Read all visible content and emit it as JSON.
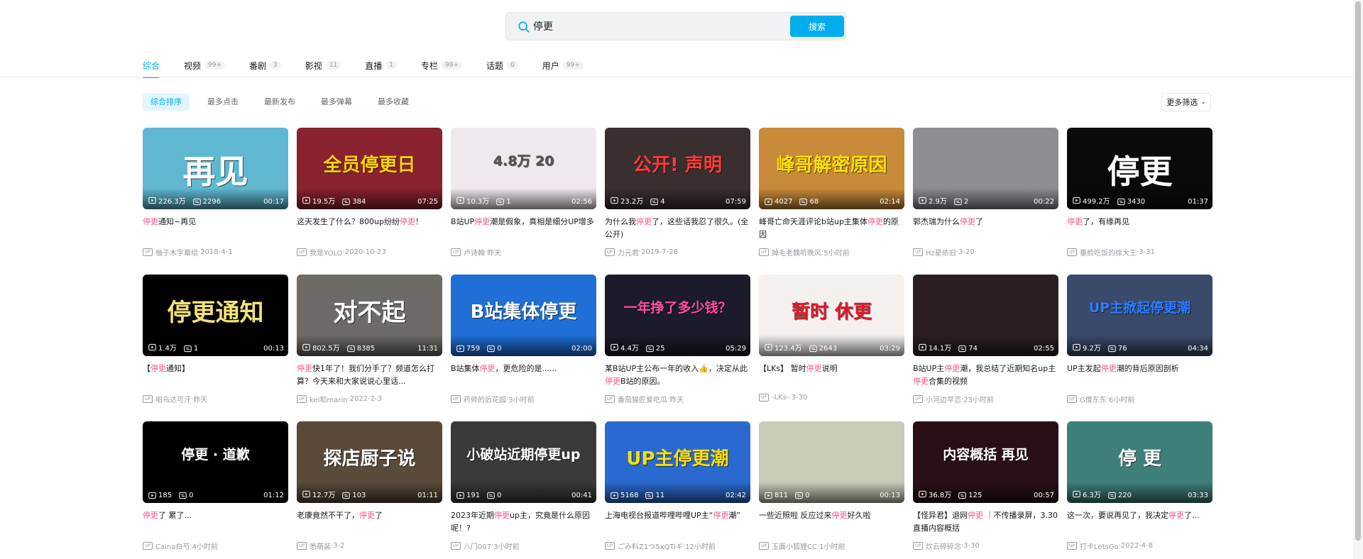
{
  "search": {
    "value": "停更",
    "button_label": "搜索"
  },
  "tabs": [
    {
      "label": "综合",
      "count": "",
      "active": true
    },
    {
      "label": "视频",
      "count": "99+"
    },
    {
      "label": "番剧",
      "count": "3"
    },
    {
      "label": "影视",
      "count": "11"
    },
    {
      "label": "直播",
      "count": "1"
    },
    {
      "label": "专栏",
      "count": "99+"
    },
    {
      "label": "话题",
      "count": "0"
    },
    {
      "label": "用户",
      "count": "99+"
    }
  ],
  "sort": [
    {
      "label": "综合排序",
      "active": true
    },
    {
      "label": "最多点击"
    },
    {
      "label": "最新发布"
    },
    {
      "label": "最多弹幕"
    },
    {
      "label": "最多收藏"
    }
  ],
  "filter_label": "更多筛选",
  "videos": [
    {
      "thumb_text": "再见",
      "thumb_bg": "#5fb8d0",
      "thumb_color": "#ffffff",
      "views": "226.3万",
      "danmaku": "2296",
      "duration": "00:17",
      "title_parts": [
        {
          "t": "停更",
          "hl": true
        },
        {
          "t": "通知~再见"
        }
      ],
      "up": "柚子木字幕组",
      "date": "2018-4-1"
    },
    {
      "thumb_text": "全员停更日",
      "thumb_bg": "#8a2230",
      "thumb_color": "#ffd400",
      "views": "19.5万",
      "danmaku": "384",
      "duration": "07:25",
      "title_parts": [
        {
          "t": "这天发生了什么？800up纷纷"
        },
        {
          "t": "停更",
          "hl": true
        },
        {
          "t": "！"
        }
      ],
      "up": "我是YOLO",
      "date": "2020-10-23"
    },
    {
      "thumb_text": "4.8万  20",
      "thumb_bg": "#f0e8ef",
      "thumb_color": "#555555",
      "views": "10.3万",
      "danmaku": "1",
      "duration": "02:56",
      "title_parts": [
        {
          "t": "B站UP"
        },
        {
          "t": "停更",
          "hl": true
        },
        {
          "t": "潮是假象，真相是细分UP增多"
        }
      ],
      "up": "卢诗翰",
      "date": "昨天"
    },
    {
      "thumb_text": "公开! 声明",
      "thumb_bg": "#3a2f2f",
      "thumb_color": "#ff3b3b",
      "views": "23.2万",
      "danmaku": "4",
      "duration": "07:59",
      "title_parts": [
        {
          "t": "为什么我"
        },
        {
          "t": "停更",
          "hl": true
        },
        {
          "t": "了，这些话我忍了很久。(全公开)"
        }
      ],
      "up": "力元君",
      "date": "2019-7-28"
    },
    {
      "thumb_text": "峰哥解密原因",
      "thumb_bg": "#c98a3a",
      "thumb_color": "#ffe000",
      "views": "4027",
      "danmaku": "68",
      "duration": "02:14",
      "title_parts": [
        {
          "t": "峰哥亡命天涯评论b站up主集体"
        },
        {
          "t": "停更",
          "hl": true
        },
        {
          "t": "的原因"
        }
      ],
      "up": "掉毛老魏听晚风",
      "date": "5小时前"
    },
    {
      "thumb_text": "",
      "thumb_bg": "#8a8f94",
      "thumb_color": "#ffffff",
      "views": "2.9万",
      "danmaku": "2",
      "duration": "00:22",
      "title_parts": [
        {
          "t": "郭杰瑞为什么"
        },
        {
          "t": "停更",
          "hl": true
        },
        {
          "t": "了"
        }
      ],
      "up": "Hz星依旧",
      "date": "3-20"
    },
    {
      "thumb_text": "停更",
      "thumb_bg": "#0a0a0a",
      "thumb_color": "#ffffff",
      "views": "499.2万",
      "danmaku": "3430",
      "duration": "01:37",
      "title_parts": [
        {
          "t": "停更",
          "hl": true
        },
        {
          "t": "了，有缘再见"
        }
      ],
      "up": "垂脸吃饭的徐大王",
      "date": "3-31"
    },
    {
      "thumb_text": "停更通知",
      "thumb_bg": "#000000",
      "thumb_color": "#f0e27a",
      "views": "1.4万",
      "danmaku": "1",
      "duration": "00:13",
      "title_parts": [
        {
          "t": "【"
        },
        {
          "t": "停更",
          "hl": true
        },
        {
          "t": "通知】"
        }
      ],
      "up": "昭乌达可汗",
      "date": "昨天"
    },
    {
      "thumb_text": "对不起",
      "thumb_bg": "#6e6a66",
      "thumb_color": "#ffffff",
      "views": "802.5万",
      "danmaku": "8385",
      "duration": "11:31",
      "title_parts": [
        {
          "t": "停更",
          "hl": true
        },
        {
          "t": "快1年了！我们分手了？频道怎么打算？今天来和大家说说心里话..."
        }
      ],
      "up": "kei和marin",
      "date": "2022-2-3"
    },
    {
      "thumb_text": "B站集体停更",
      "thumb_bg": "#1f6fd6",
      "thumb_color": "#ffffff",
      "views": "759",
      "danmaku": "0",
      "duration": "02:00",
      "title_parts": [
        {
          "t": "B站集体"
        },
        {
          "t": "停更",
          "hl": true
        },
        {
          "t": "，更危险的是......"
        }
      ],
      "up": "药师的后花园",
      "date": "3小时前"
    },
    {
      "thumb_text": "一年挣了多少钱？",
      "thumb_bg": "#1b1b2a",
      "thumb_color": "#ff4fa0",
      "views": "4.4万",
      "danmaku": "25",
      "duration": "05:29",
      "title_parts": [
        {
          "t": "某B站UP主公布一年的收入👍，决定从此"
        },
        {
          "t": "停更",
          "hl": true
        },
        {
          "t": "B站的原因。"
        }
      ],
      "up": "番茄猫匠爱吃瓜",
      "date": "昨天"
    },
    {
      "thumb_text": "暂时 休更",
      "thumb_bg": "#f4f0ee",
      "thumb_color": "#e0182a",
      "views": "123.4万",
      "danmaku": "2643",
      "duration": "03:29",
      "title_parts": [
        {
          "t": "【LKs】 暂时"
        },
        {
          "t": "停更",
          "hl": true
        },
        {
          "t": "说明"
        }
      ],
      "up": "-LKs-",
      "date": "3-30"
    },
    {
      "thumb_text": "",
      "thumb_bg": "#2a1f1f",
      "thumb_color": "#ffd400",
      "views": "14.1万",
      "danmaku": "74",
      "duration": "02:55",
      "title_parts": [
        {
          "t": "B站UP主"
        },
        {
          "t": "停更",
          "hl": true
        },
        {
          "t": "潮，我总结了近期知名up主"
        },
        {
          "t": "停更",
          "hl": true
        },
        {
          "t": "合集的视频"
        }
      ],
      "up": "小河边早恋",
      "date": "23小时前"
    },
    {
      "thumb_text": "UP主掀起停更潮",
      "thumb_bg": "#3a4a6a",
      "thumb_color": "#2f7cff",
      "views": "9.2万",
      "danmaku": "76",
      "duration": "04:34",
      "title_parts": [
        {
          "t": "UP主发起"
        },
        {
          "t": "停更",
          "hl": true
        },
        {
          "t": "潮的背后原因剖析"
        }
      ],
      "up": "G僧东东",
      "date": "6小时前"
    },
    {
      "thumb_text": "停更 · 道歉",
      "thumb_bg": "#000000",
      "thumb_color": "#ffffff",
      "views": "185",
      "danmaku": "0",
      "duration": "01:12",
      "title_parts": [
        {
          "t": "停更",
          "hl": true
        },
        {
          "t": "了 累了..."
        }
      ],
      "up": "Caina白芍",
      "date": "4小时前"
    },
    {
      "thumb_text": "探店厨子说",
      "thumb_bg": "#5a4a3a",
      "thumb_color": "#ffffff",
      "views": "12.7万",
      "danmaku": "103",
      "duration": "01:11",
      "title_parts": [
        {
          "t": "老康竟然不干了，"
        },
        {
          "t": "停更",
          "hl": true
        },
        {
          "t": "了"
        }
      ],
      "up": "悉萌装",
      "date": "3-2"
    },
    {
      "thumb_text": "小破站近期停更up",
      "thumb_bg": "#3a3a3a",
      "thumb_color": "#ffffff",
      "views": "191",
      "danmaku": "0",
      "duration": "00:41",
      "title_parts": [
        {
          "t": "2023年近期"
        },
        {
          "t": "停更",
          "hl": true
        },
        {
          "t": "up主，究竟是什么原因呢！?"
        }
      ],
      "up": "八门007",
      "date": "3小时前"
    },
    {
      "thumb_text": "UP主停更潮",
      "thumb_bg": "#2a6ad0",
      "thumb_color": "#ffe000",
      "views": "5168",
      "danmaku": "11",
      "duration": "02:42",
      "title_parts": [
        {
          "t": "上海电视台报道哔哩哔哩UP主“"
        },
        {
          "t": "停更",
          "hl": true
        },
        {
          "t": "潮”"
        }
      ],
      "up": "ごみ料Z1つ5xQTiギ",
      "date": "12小时前"
    },
    {
      "thumb_text": "",
      "thumb_bg": "#c8cbb8",
      "thumb_color": "#ffffff",
      "views": "811",
      "danmaku": "0",
      "duration": "00:13",
      "title_parts": [
        {
          "t": "一些近照啦 反应过来"
        },
        {
          "t": "停更",
          "hl": true
        },
        {
          "t": "好久啦"
        }
      ],
      "up": "玉面小狐貍CC",
      "date": "1小时前"
    },
    {
      "thumb_text": "内容概括 再见",
      "thumb_bg": "#2a1014",
      "thumb_color": "#ffffff",
      "views": "36.8万",
      "danmaku": "125",
      "duration": "00:57",
      "title_parts": [
        {
          "t": "【怪异君】退网"
        },
        {
          "t": "停更",
          "hl": true
        },
        {
          "t": " ｜不传播录屏，3.30直播内容概括"
        }
      ],
      "up": "炊云碎碎念",
      "date": "3-30"
    },
    {
      "thumb_text": "停    更",
      "thumb_bg": "#3f7f7a",
      "thumb_color": "#ffffff",
      "views": "6.3万",
      "danmaku": "220",
      "duration": "03:33",
      "title_parts": [
        {
          "t": "这一次，要说再见了，我决定"
        },
        {
          "t": "停更",
          "hl": true
        },
        {
          "t": "了..."
        }
      ],
      "up": "打卡LetsGo",
      "date": "2022-4-8"
    }
  ]
}
